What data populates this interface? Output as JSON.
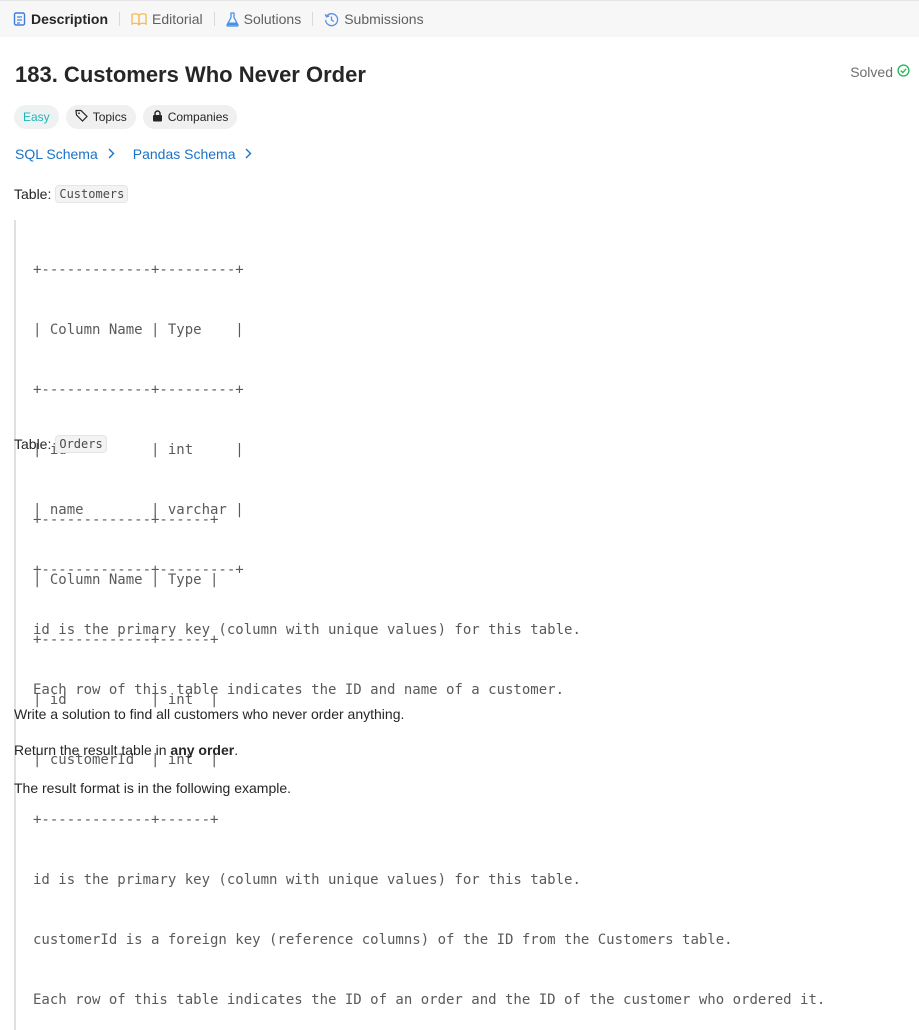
{
  "tabs": [
    {
      "label": "Description",
      "icon": "description-icon",
      "active": true
    },
    {
      "label": "Editorial",
      "icon": "book-icon",
      "active": false
    },
    {
      "label": "Solutions",
      "icon": "flask-icon",
      "active": false
    },
    {
      "label": "Submissions",
      "icon": "history-icon",
      "active": false
    }
  ],
  "problem": {
    "title": "183. Customers Who Never Order",
    "status": "Solved",
    "difficulty": "Easy",
    "topics_label": "Topics",
    "companies_label": "Companies"
  },
  "schemas": {
    "sql": "SQL Schema",
    "pandas": "Pandas Schema"
  },
  "customers_table": {
    "label": "Table:",
    "name": "Customers",
    "lines": [
      "+-------------+---------+",
      "| Column Name | Type    |",
      "+-------------+---------+",
      "| id          | int     |",
      "| name        | varchar |",
      "+-------------+---------+",
      "id is the primary key (column with unique values) for this table.",
      "Each row of this table indicates the ID and name of a customer."
    ]
  },
  "orders_table": {
    "label": "Table:",
    "name": "Orders",
    "lines": [
      "+-------------+------+",
      "| Column Name | Type |",
      "+-------------+------+",
      "| id          | int  |",
      "| customerId  | int  |",
      "+-------------+------+",
      "id is the primary key (column with unique values) for this table.",
      "customerId is a foreign key (reference columns) of the ID from the Customers table.",
      "Each row of this table indicates the ID of an order and the ID of the customer who ordered it."
    ]
  },
  "description": {
    "p1": "Write a solution to find all customers who never order anything.",
    "p2_prefix": "Return the result table in ",
    "p2_bold": "any order",
    "p2_suffix": ".",
    "p3": "The result format is in the following example."
  },
  "colors": {
    "easy": "#1cb8b8",
    "solved": "#2db55d",
    "link": "#1a73c8",
    "active_tab_icon": "#3b7ddd",
    "editorial_icon": "#f5b94d",
    "solutions_icon": "#4a90e2",
    "submissions_icon": "#5b8fe0"
  }
}
